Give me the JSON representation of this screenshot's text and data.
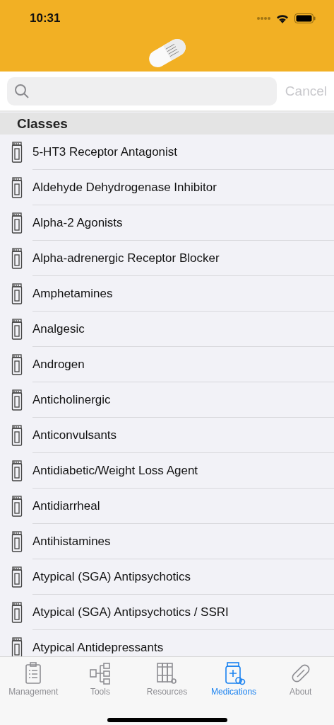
{
  "status_bar": {
    "time": "10:31"
  },
  "search": {
    "cancel": "Cancel"
  },
  "section": {
    "title": "Classes"
  },
  "items": [
    {
      "label": "5-HT3 Receptor Antagonist"
    },
    {
      "label": "Aldehyde Dehydrogenase Inhibitor"
    },
    {
      "label": "Alpha-2 Agonists"
    },
    {
      "label": "Alpha-adrenergic Receptor Blocker"
    },
    {
      "label": "Amphetamines"
    },
    {
      "label": "Analgesic"
    },
    {
      "label": "Androgen"
    },
    {
      "label": "Anticholinergic"
    },
    {
      "label": "Anticonvulsants"
    },
    {
      "label": "Antidiabetic/Weight Loss Agent"
    },
    {
      "label": "Antidiarrheal"
    },
    {
      "label": "Antihistamines"
    },
    {
      "label": "Atypical (SGA) Antipsychotics"
    },
    {
      "label": "Atypical (SGA) Antipsychotics / SSRI"
    },
    {
      "label": "Atypical Antidepressants"
    }
  ],
  "tabs": [
    {
      "label": "Management",
      "kind": "clipboard",
      "selected": false
    },
    {
      "label": "Tools",
      "kind": "tree",
      "selected": false
    },
    {
      "label": "Resources",
      "kind": "books",
      "selected": false
    },
    {
      "label": "Medications",
      "kind": "bottle",
      "selected": true
    },
    {
      "label": "About",
      "kind": "pill",
      "selected": false
    }
  ]
}
